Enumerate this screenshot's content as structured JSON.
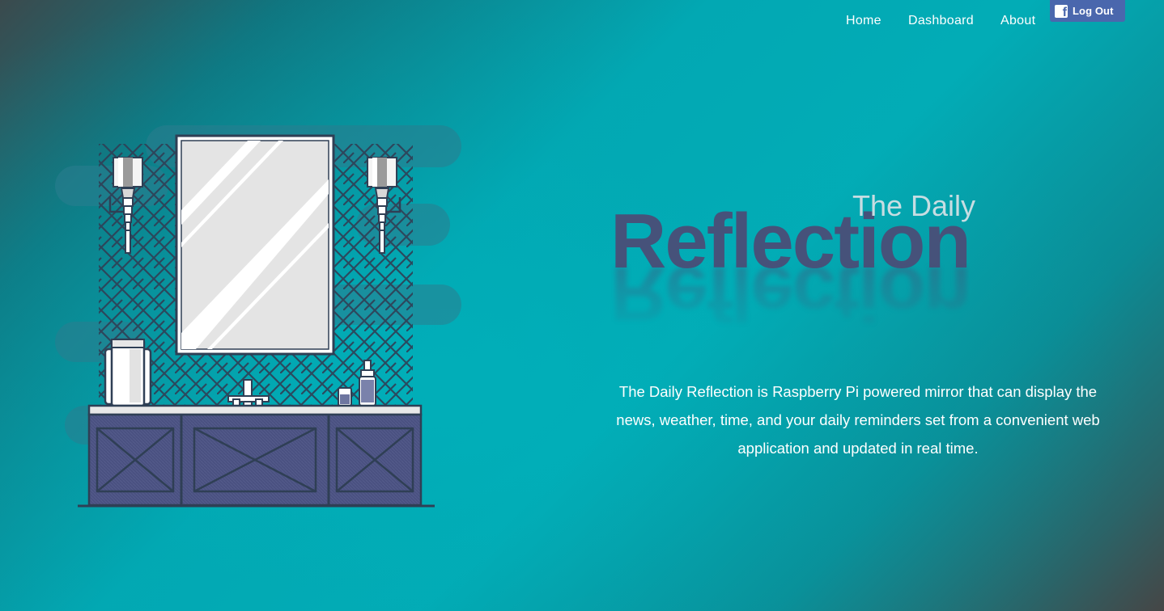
{
  "nav": {
    "links": [
      {
        "label": "Home"
      },
      {
        "label": "Dashboard"
      },
      {
        "label": "About"
      }
    ],
    "logout": {
      "label": "Log Out",
      "icon": "facebook-icon",
      "color": "#4a67ad"
    }
  },
  "hero": {
    "subtitle": "The Daily",
    "title": "Reflection",
    "description": "The Daily Reflection is Raspberry Pi powered mirror that can display the news, weather, time, and your daily reminders set from a convenient web application and updated in real time."
  },
  "illustration": {
    "icon": "bathroom-vanity-mirror-illustration"
  },
  "colors": {
    "title": "#46527a",
    "subtitle": "#c7dde2",
    "background": "#02a8b3",
    "cabinet": "#4a5181"
  }
}
